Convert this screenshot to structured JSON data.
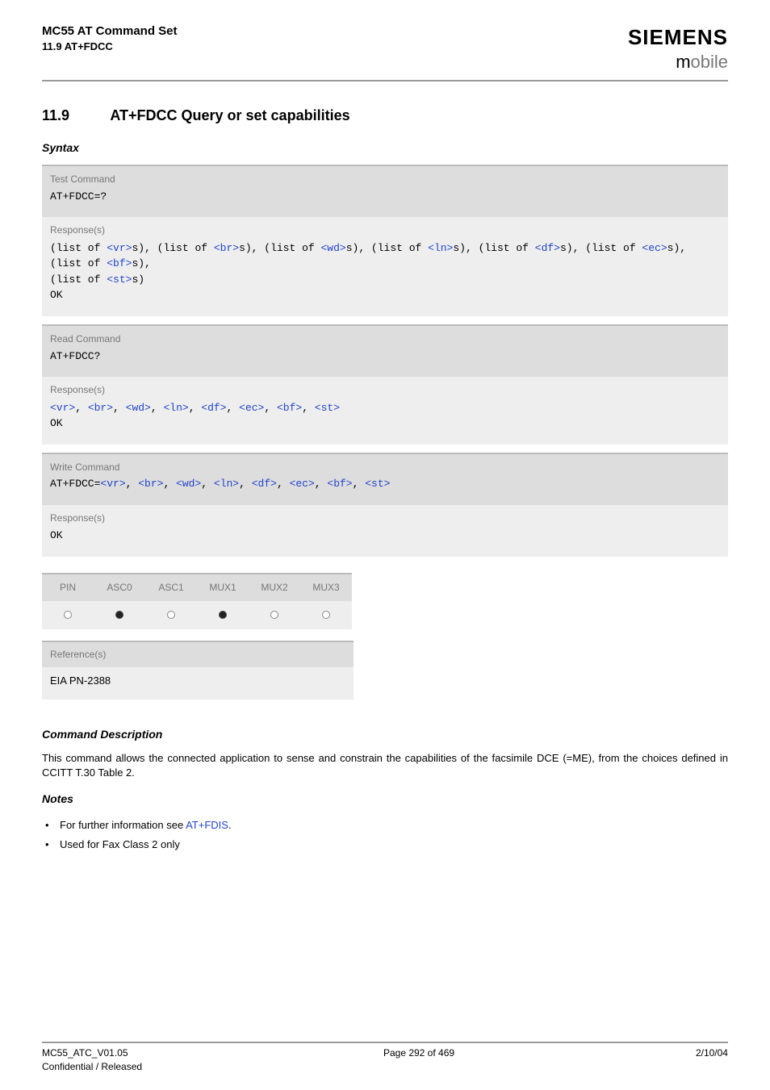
{
  "header": {
    "doc_title": "MC55 AT Command Set",
    "doc_section_ref": "11.9 AT+FDCC",
    "brand": "SIEMENS",
    "brand_sub_m": "m",
    "brand_sub_rest": "obile"
  },
  "section": {
    "number": "11.9",
    "title": "AT+FDCC   Query or set capabilities"
  },
  "labels": {
    "syntax": "Syntax",
    "command_description": "Command Description",
    "notes": "Notes"
  },
  "blocks": {
    "test": {
      "head_label": "Test Command",
      "cmd": "AT+FDCC=?",
      "resp_label": "Response(s)",
      "resp_lines": [
        [
          {
            "t": "(list of ",
            "k": "txt"
          },
          {
            "t": "<vr>",
            "k": "param"
          },
          {
            "t": "s), (list of ",
            "k": "txt"
          },
          {
            "t": "<br>",
            "k": "param"
          },
          {
            "t": "s), (list of ",
            "k": "txt"
          },
          {
            "t": "<wd>",
            "k": "param"
          },
          {
            "t": "s), (list of ",
            "k": "txt"
          },
          {
            "t": "<ln>",
            "k": "param"
          },
          {
            "t": "s), (list of ",
            "k": "txt"
          },
          {
            "t": "<df>",
            "k": "param"
          },
          {
            "t": "s), (list of ",
            "k": "txt"
          },
          {
            "t": "<ec>",
            "k": "param"
          },
          {
            "t": "s), (list of ",
            "k": "txt"
          },
          {
            "t": "<bf>",
            "k": "param"
          },
          {
            "t": "s),",
            "k": "txt"
          }
        ],
        [
          {
            "t": "(list of ",
            "k": "txt"
          },
          {
            "t": "<st>",
            "k": "param"
          },
          {
            "t": "s)",
            "k": "txt"
          }
        ],
        [
          {
            "t": "OK",
            "k": "txt"
          }
        ]
      ]
    },
    "read": {
      "head_label": "Read Command",
      "cmd": "AT+FDCC?",
      "resp_label": "Response(s)",
      "resp_line": [
        {
          "t": "<vr>",
          "k": "param"
        },
        {
          "t": ", ",
          "k": "txt"
        },
        {
          "t": "<br>",
          "k": "param"
        },
        {
          "t": ", ",
          "k": "txt"
        },
        {
          "t": "<wd>",
          "k": "param"
        },
        {
          "t": ", ",
          "k": "txt"
        },
        {
          "t": "<ln>",
          "k": "param"
        },
        {
          "t": ", ",
          "k": "txt"
        },
        {
          "t": "<df>",
          "k": "param"
        },
        {
          "t": ", ",
          "k": "txt"
        },
        {
          "t": "<ec>",
          "k": "param"
        },
        {
          "t": ", ",
          "k": "txt"
        },
        {
          "t": "<bf>",
          "k": "param"
        },
        {
          "t": ", ",
          "k": "txt"
        },
        {
          "t": "<st>",
          "k": "param"
        }
      ],
      "ok": "OK"
    },
    "write": {
      "head_label": "Write Command",
      "cmd_prefix": "AT+FDCC=",
      "cmd_params": [
        {
          "t": "<vr>",
          "k": "param"
        },
        {
          "t": ", ",
          "k": "txt"
        },
        {
          "t": "<br>",
          "k": "param"
        },
        {
          "t": ", ",
          "k": "txt"
        },
        {
          "t": "<wd>",
          "k": "param"
        },
        {
          "t": ", ",
          "k": "txt"
        },
        {
          "t": "<ln>",
          "k": "param"
        },
        {
          "t": ", ",
          "k": "txt"
        },
        {
          "t": "<df>",
          "k": "param"
        },
        {
          "t": ", ",
          "k": "txt"
        },
        {
          "t": "<ec>",
          "k": "param"
        },
        {
          "t": ", ",
          "k": "txt"
        },
        {
          "t": "<bf>",
          "k": "param"
        },
        {
          "t": ", ",
          "k": "txt"
        },
        {
          "t": "<st>",
          "k": "param"
        }
      ],
      "resp_label": "Response(s)",
      "ok": "OK"
    }
  },
  "matrix": {
    "cols": [
      "PIN",
      "ASC0",
      "ASC1",
      "MUX1",
      "MUX2",
      "MUX3"
    ],
    "vals": [
      "open",
      "filled",
      "open",
      "filled",
      "open",
      "open"
    ]
  },
  "reference": {
    "head": "Reference(s)",
    "body": "EIA PN-2388"
  },
  "command_description_text": "This command allows the connected application to sense and constrain the capabilities of the facsimile DCE (=ME), from the choices defined in CCITT T.30 Table 2.",
  "notes": [
    {
      "prefix": "For further information see ",
      "link": "AT+FDIS",
      "suffix": "."
    },
    {
      "prefix": "Used for Fax Class 2 only",
      "link": "",
      "suffix": ""
    }
  ],
  "footer": {
    "left1": "MC55_ATC_V01.05",
    "left2": "Confidential / Released",
    "center": "Page 292 of 469",
    "right": "2/10/04"
  }
}
